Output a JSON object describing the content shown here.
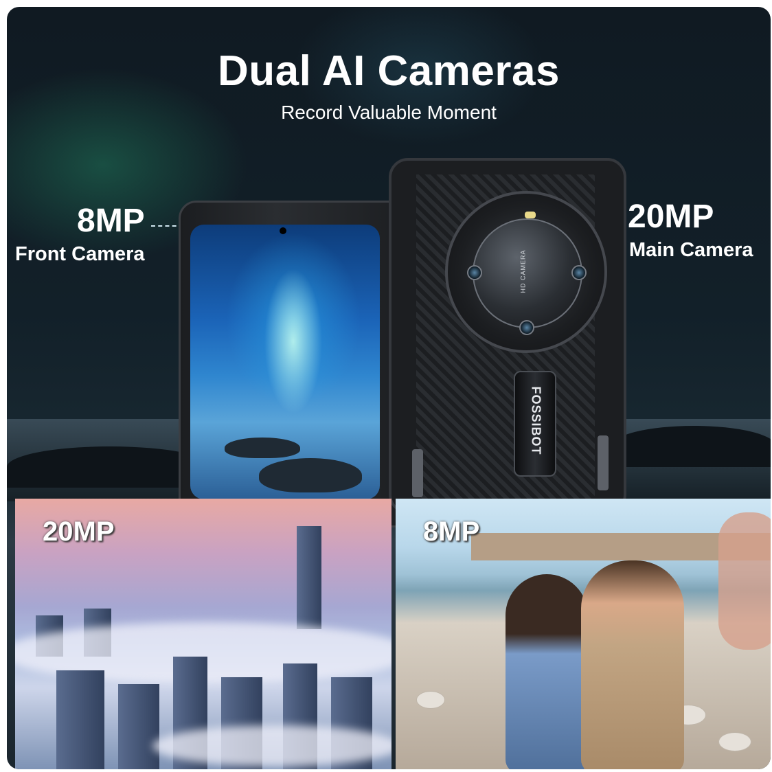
{
  "header": {
    "title": "Dual AI Cameras",
    "subtitle": "Record Valuable Moment"
  },
  "front_camera": {
    "resolution": "8MP",
    "label": "Front Camera"
  },
  "main_camera": {
    "resolution": "20MP",
    "label": "Main Camera"
  },
  "phone": {
    "brand": "FOSSIBOT",
    "lens_text": "HD CAMERA"
  },
  "samples": [
    {
      "label": "20MP",
      "scene": "city-in-clouds"
    },
    {
      "label": "8MP",
      "scene": "beach-selfie"
    }
  ],
  "colors": {
    "text": "#ffffff",
    "background": "#122029",
    "dash": "#d0e6f0"
  }
}
